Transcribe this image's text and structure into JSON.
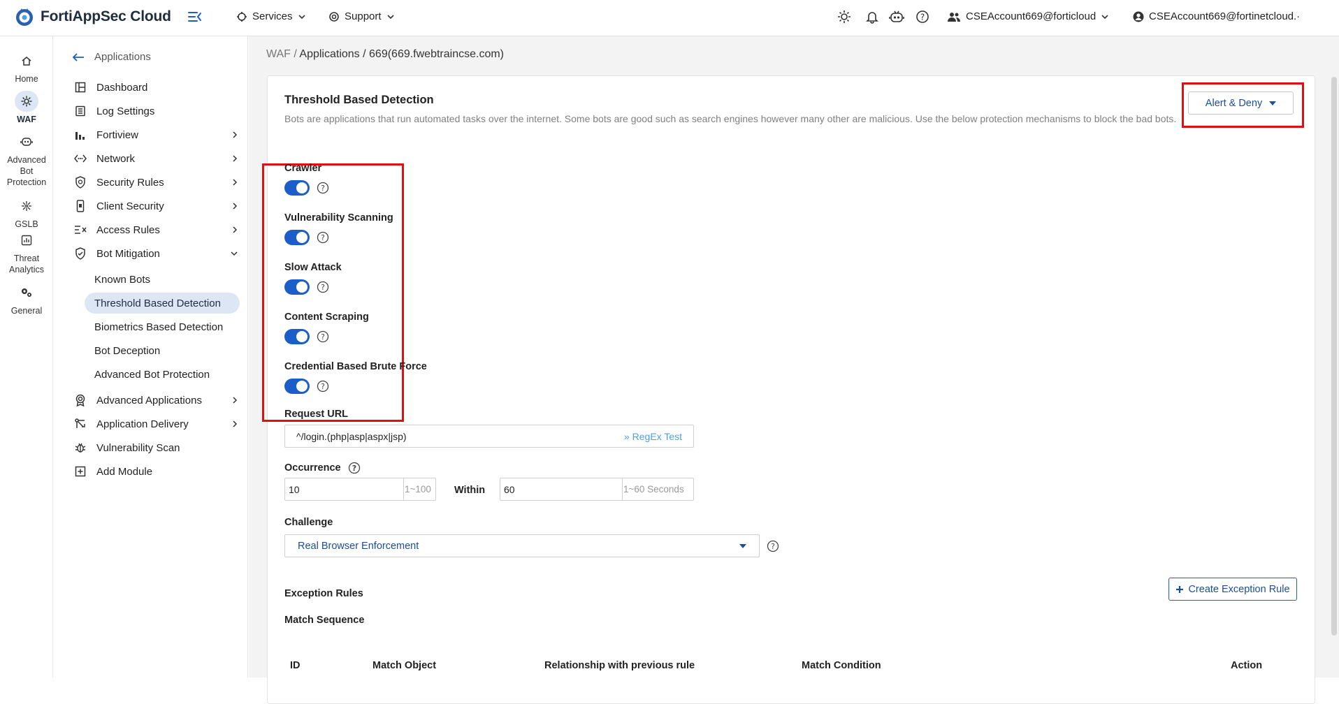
{
  "app": {
    "title": "FortiAppSec Cloud"
  },
  "topnav": {
    "services": "Services",
    "support": "Support"
  },
  "accounts": {
    "account1": "CSEAccount669@forticloud",
    "account2": "CSEAccount669@fortinetcloud.·"
  },
  "rail": [
    {
      "label": "Home",
      "icon": "home-icon"
    },
    {
      "label": "WAF",
      "icon": "waf-icon",
      "active": true
    },
    {
      "label": "Advanced Bot Protection",
      "icon": "bot-icon"
    },
    {
      "label": "GSLB",
      "icon": "gslb-icon"
    },
    {
      "label": "Threat Analytics",
      "icon": "analytics-icon"
    },
    {
      "label": "General",
      "icon": "gears-icon"
    }
  ],
  "sidebar": {
    "back": "Applications",
    "items": [
      {
        "label": "Dashboard",
        "icon": "dashboard-icon"
      },
      {
        "label": "Log Settings",
        "icon": "log-icon"
      },
      {
        "label": "Fortiview",
        "icon": "chart-icon",
        "expandable": true
      },
      {
        "label": "Network",
        "icon": "network-icon",
        "expandable": true
      },
      {
        "label": "Security Rules",
        "icon": "shield-icon",
        "expandable": true
      },
      {
        "label": "Client Security",
        "icon": "phone-icon",
        "expandable": true
      },
      {
        "label": "Access Rules",
        "icon": "access-icon",
        "expandable": true
      },
      {
        "label": "Bot Mitigation",
        "icon": "bot-shield-icon",
        "expanded": true
      }
    ],
    "bot_sub": [
      "Known Bots",
      "Threshold Based Detection",
      "Biometrics Based Detection",
      "Bot Deception",
      "Advanced Bot Protection"
    ],
    "items2": [
      {
        "label": "Advanced Applications",
        "icon": "badge-icon",
        "expandable": true
      },
      {
        "label": "Application Delivery",
        "icon": "delivery-icon",
        "expandable": true
      },
      {
        "label": "Vulnerability Scan",
        "icon": "bug-icon"
      },
      {
        "label": "Add Module",
        "icon": "plus-square-icon"
      }
    ]
  },
  "breadcrumb": {
    "root": "WAF",
    "sep": " / ",
    "path": "Applications / 669(669.fwebtraincse.com)"
  },
  "section": {
    "title": "Threshold Based Detection",
    "description": "Bots are applications that run automated tasks over the internet. Some bots are good such as search engines however many other are malicious. Use the below protection mechanisms to block the bad bots.",
    "mode": "Alert & Deny"
  },
  "toggles": [
    {
      "label": "Crawler",
      "enabled": true
    },
    {
      "label": "Vulnerability Scanning",
      "enabled": true
    },
    {
      "label": "Slow Attack",
      "enabled": true
    },
    {
      "label": "Content Scraping",
      "enabled": true
    },
    {
      "label": "Credential Based Brute Force",
      "enabled": true
    }
  ],
  "form": {
    "request_url_label": "Request URL",
    "request_url_value": "^/login.(php|asp|aspx|jsp)",
    "regex_test": "» RegEx Test",
    "occurrence_label": "Occurrence",
    "occurrence_value": "10",
    "occurrence_hint": "1~100",
    "within_label": "Within",
    "within_value": "60",
    "within_hint": "1~60 Seconds",
    "challenge_label": "Challenge",
    "challenge_value": "Real Browser Enforcement"
  },
  "exceptions": {
    "label": "Exception Rules",
    "create_button": "Create Exception Rule",
    "match_sequence": "Match Sequence",
    "columns": [
      "ID",
      "Match Object",
      "Relationship with previous rule",
      "Match Condition",
      "Action"
    ]
  },
  "colors": {
    "accent": "#1c5ec9",
    "highlight": "#e01010",
    "active_bg": "#dde6f5"
  }
}
